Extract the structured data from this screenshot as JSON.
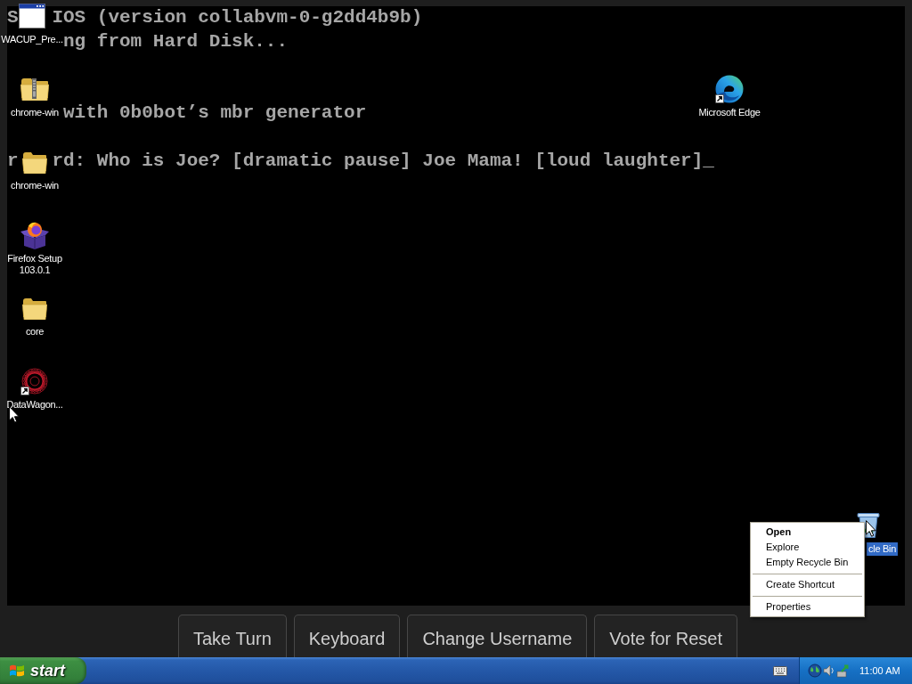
{
  "console": {
    "lines": [
      {
        "segments": [
          "S",
          "IOS (version collabvm-0-g2dd4b9b)"
        ]
      },
      {
        "segments": [
          "ng from Hard Disk..."
        ]
      },
      {
        "segments": [
          "with 0b0bot’s mbr generator"
        ]
      },
      {
        "segments": [
          "r",
          "rd: Who is Joe? [dramatic pause] Joe Mama! [loud laughter]_"
        ]
      }
    ]
  },
  "desktop_icons": [
    {
      "kind": "window",
      "label": "WACUP_Pre...",
      "shortcut": false,
      "selected": false
    },
    {
      "kind": "zip-folder",
      "label": "chrome-win",
      "shortcut": false,
      "selected": false
    },
    {
      "kind": "folder",
      "label": "chrome-win",
      "shortcut": false,
      "selected": false
    },
    {
      "kind": "installer",
      "label": "Firefox Setup 103.0.1",
      "shortcut": false,
      "selected": false
    },
    {
      "kind": "folder",
      "label": "core",
      "shortcut": false,
      "selected": false
    },
    {
      "kind": "mandala",
      "label": "DataWagon...",
      "shortcut": true,
      "selected": false
    },
    {
      "kind": "edge",
      "label": "Microsoft Edge",
      "shortcut": true,
      "selected": false
    },
    {
      "kind": "recycle-bin",
      "label": "cle Bin",
      "shortcut": false,
      "selected": true
    }
  ],
  "context_menu": {
    "groups": [
      [
        {
          "label": "Open",
          "default": true
        },
        {
          "label": "Explore",
          "default": false
        },
        {
          "label": "Empty Recycle Bin",
          "default": false
        }
      ],
      [
        {
          "label": "Create Shortcut",
          "default": false
        }
      ],
      [
        {
          "label": "Properties",
          "default": false
        }
      ]
    ]
  },
  "toolbar": {
    "buttons": [
      "Take Turn",
      "Keyboard",
      "Change Username",
      "Vote for Reset"
    ]
  },
  "taskbar": {
    "start_label": "start",
    "clock": "11:00 AM"
  }
}
